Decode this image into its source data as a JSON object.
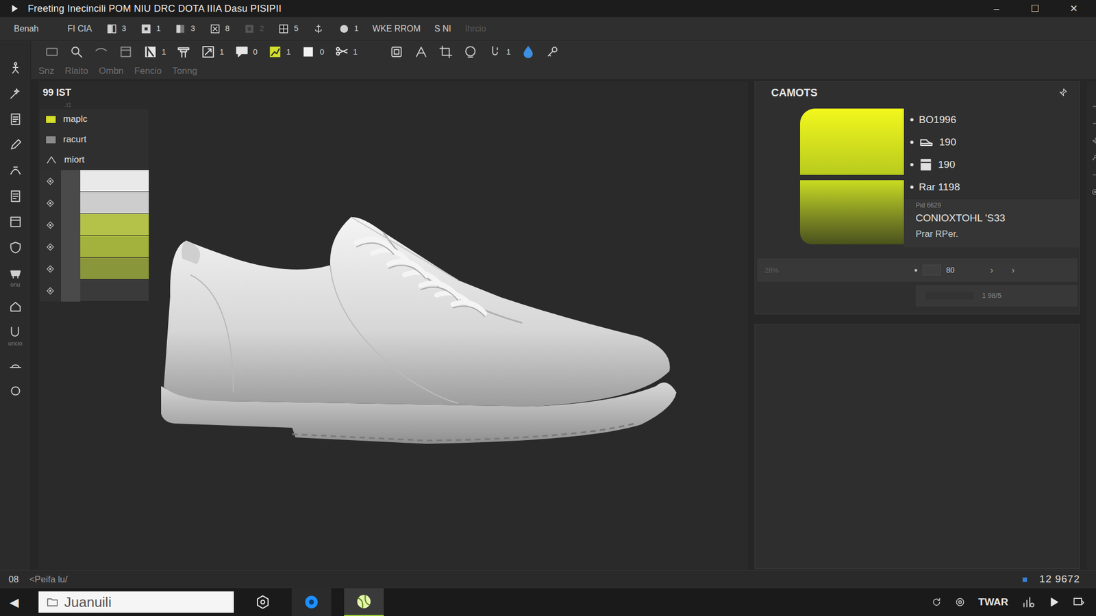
{
  "window": {
    "title": "Freeting Inecincili POM NIU DRC DOTA IIIA Dasu PISIPII",
    "controls": [
      "–",
      "☐",
      "✕"
    ]
  },
  "toolbar": {
    "items": [
      {
        "kind": "text",
        "label": "Benah",
        "disabled": false
      },
      {
        "kind": "text",
        "label": "FI CIA",
        "disabled": false
      },
      {
        "kind": "counter",
        "label": "3",
        "disabled": false
      },
      {
        "kind": "counter",
        "label": "1",
        "disabled": false
      },
      {
        "kind": "counter",
        "label": "3",
        "disabled": false
      },
      {
        "kind": "counter",
        "label": "8",
        "disabled": false
      },
      {
        "kind": "counter",
        "label": "2",
        "disabled": true
      },
      {
        "kind": "counter",
        "label": "5",
        "disabled": false
      },
      {
        "kind": "icon",
        "disabled": false
      },
      {
        "kind": "counter",
        "label": "1",
        "disabled": false
      },
      {
        "kind": "text",
        "label": "WKE RROM",
        "disabled": false
      },
      {
        "kind": "text",
        "label": "S NI",
        "disabled": false
      },
      {
        "kind": "text",
        "label": "Ihrcio",
        "disabled": true
      }
    ]
  },
  "tools": {
    "items": [
      {
        "kind": "icon",
        "color": "#8f8f8f"
      },
      {
        "kind": "icon",
        "color": "#cfcfcf"
      },
      {
        "kind": "icon",
        "color": "#8f8f8f"
      },
      {
        "kind": "icon",
        "color": "#8f8f8f"
      },
      {
        "kind": "counter",
        "label": "1",
        "color": "#e6e6e6"
      },
      {
        "kind": "icon",
        "color": "#e6e6e6"
      },
      {
        "kind": "counter",
        "label": "1",
        "color": "#e6e6e6"
      },
      {
        "kind": "counter",
        "label": "0",
        "color": "#e6e6e6"
      },
      {
        "kind": "counter",
        "label": "1",
        "color": "#d4e02a"
      },
      {
        "kind": "counter",
        "label": "0",
        "color": "#f2f2f2"
      },
      {
        "kind": "counter",
        "label": "1",
        "color": "#e6e6e6"
      },
      {
        "kind": "icon",
        "color": "#cfcfcf"
      },
      {
        "kind": "icon",
        "color": "#cfcfcf"
      },
      {
        "kind": "icon",
        "color": "#cfcfcf"
      },
      {
        "kind": "icon",
        "color": "#cfcfcf"
      },
      {
        "kind": "counter",
        "label": "1",
        "color": "#cfcfcf"
      },
      {
        "kind": "icon",
        "color": "#3d8fe0"
      },
      {
        "kind": "icon",
        "color": "#cfcfcf"
      }
    ]
  },
  "tabs": [
    {
      "label": "Snz"
    },
    {
      "label": "Rlaito"
    },
    {
      "label": "Ombn"
    },
    {
      "label": "Fencio"
    },
    {
      "label": "Tonng"
    }
  ],
  "left_tools": [
    {
      "kind": "icon"
    },
    {
      "kind": "icon"
    },
    {
      "kind": "icon"
    },
    {
      "kind": "icon"
    },
    {
      "kind": "icon"
    },
    {
      "kind": "icon"
    },
    {
      "kind": "icon"
    },
    {
      "kind": "icon"
    },
    {
      "kind": "labeled",
      "label": "onu"
    },
    {
      "kind": "icon"
    },
    {
      "kind": "labeled",
      "label": "uncio"
    },
    {
      "kind": "icon"
    },
    {
      "kind": "icon"
    }
  ],
  "layers": {
    "title": "99 IST",
    "subtitle": "..t1",
    "items": [
      {
        "label": "maplc",
        "kind": "swatch",
        "color": "#d4e02a"
      },
      {
        "label": "racurt",
        "kind": "swatch",
        "color": "#8a8a8a"
      },
      {
        "label": "miort",
        "kind": "shape",
        "color": "#cfcfcf"
      }
    ],
    "swatches": [
      {
        "color": "#e9e9e9"
      },
      {
        "color": "#cdcdcd"
      },
      {
        "color": "#b4c24a"
      },
      {
        "color": "#a3b23c"
      },
      {
        "color": "#8a963a"
      },
      {
        "color": "#3a3a3a"
      }
    ]
  },
  "inspector": {
    "title": "CAMOTS",
    "properties": [
      {
        "kind": "bullet",
        "label": "BO1996"
      },
      {
        "kind": "shoe",
        "label": "190"
      },
      {
        "kind": "box",
        "label": "190"
      },
      {
        "kind": "bullet",
        "label": "Rar 1198"
      }
    ],
    "caption": "Pid 6629",
    "name": "CONIOXTOHL 'S33",
    "note": "Prar RPer.",
    "percent": "28%",
    "value": "80",
    "steppers": [
      "›",
      "›"
    ],
    "ratio": "1 98/5"
  },
  "status": {
    "left": "08",
    "path": "<Peifa lu/",
    "right": "12 9672"
  },
  "taskbar": {
    "back": "◀",
    "search": "Juanuili",
    "tray": "TWAR"
  }
}
